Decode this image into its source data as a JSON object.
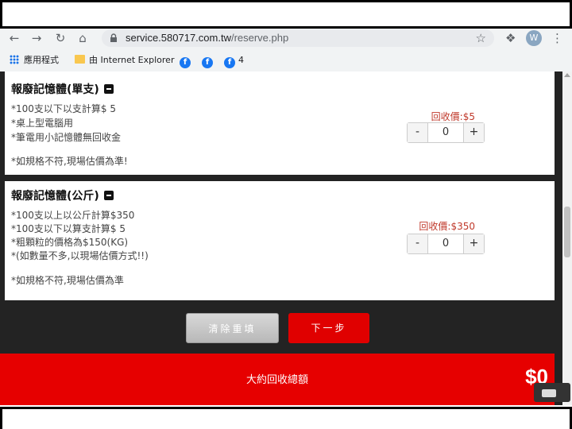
{
  "browser": {
    "url_host": "service.580717.com.tw",
    "url_path": "/reserve.php",
    "avatar_letter": "W",
    "bookmarks": {
      "apps": "應用程式",
      "ie": "由 Internet Explorer",
      "fb_count": "4"
    }
  },
  "cards": [
    {
      "title": "報廢記憶體(單支)",
      "lines": [
        "*100支以下以支計算$ 5",
        "*桌上型電腦用",
        "*筆電用小記憶體無回收金"
      ],
      "note": "*如規格不符,現場估價為準!",
      "price": "回收價:$5",
      "qty": "0"
    },
    {
      "title": "報廢記憶體(公斤)",
      "lines": [
        "*100支以上以公斤計算$350",
        "*100支以下以算支計算$ 5",
        "*粗顆粒的價格為$150(KG)",
        "*(如數量不多,以現場估價方式!!)"
      ],
      "note": "*如規格不符,現場估價為準",
      "price": "回收價:$350",
      "qty": "0"
    }
  ],
  "buttons": {
    "clear": "清除重填",
    "next": "下一步"
  },
  "total": {
    "label": "大約回收總額",
    "amount": "$0"
  },
  "icons": [
    "back-arrow-icon",
    "forward-arrow-icon",
    "reload-icon",
    "home-icon",
    "lock-icon",
    "star-icon",
    "extensions-icon",
    "menu-icon",
    "apps-icon",
    "folder-icon",
    "facebook-icon",
    "collapse-icon"
  ]
}
